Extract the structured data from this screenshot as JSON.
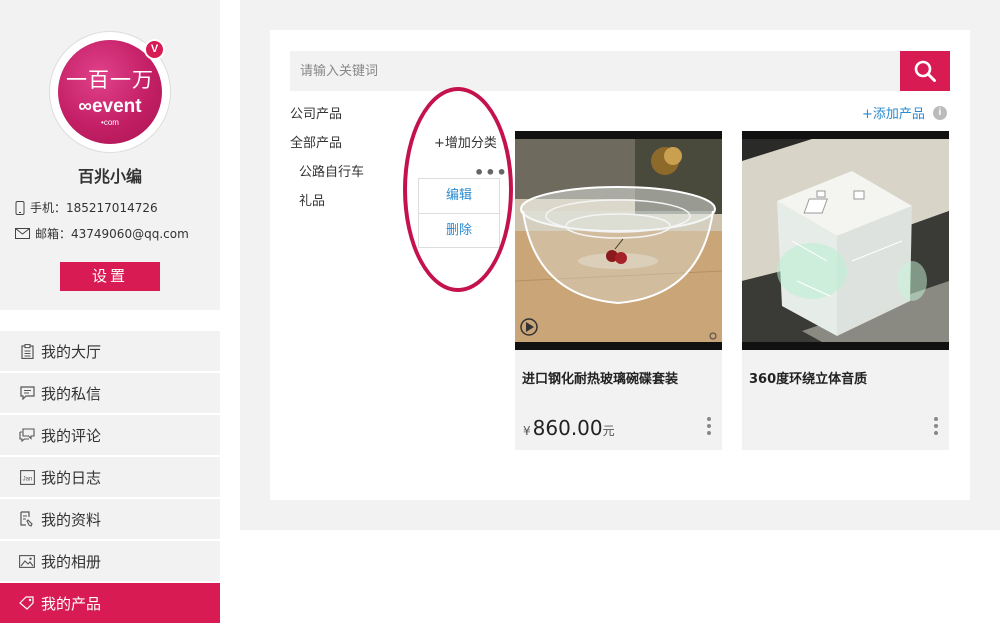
{
  "profile": {
    "avatar_text": {
      "cn": "一百一万",
      "en": "event",
      "com": "•com"
    },
    "badge": "V",
    "name": "百兆小编",
    "phone": "手机：185217014726",
    "email": "邮箱：43749060@qq.com",
    "settings_label": "设置"
  },
  "nav": {
    "items": [
      {
        "label": "我的大厅",
        "icon": "clipboard-icon"
      },
      {
        "label": "我的私信",
        "icon": "message-icon"
      },
      {
        "label": "我的评论",
        "icon": "comment-icon"
      },
      {
        "label": "我的日志",
        "icon": "calendar-icon"
      },
      {
        "label": "我的资料",
        "icon": "profile-edit-icon"
      },
      {
        "label": "我的相册",
        "icon": "photo-icon"
      },
      {
        "label": "我的产品",
        "icon": "product-tag-icon",
        "active": true
      }
    ],
    "calendar_icon_text": "Jan"
  },
  "search": {
    "placeholder": "请输入关键词"
  },
  "categories": {
    "company": "公司产品",
    "all": "全部产品",
    "add_category": "+增加分类",
    "subs": [
      "公路自行车",
      "礼品"
    ],
    "menu": {
      "edit": "编辑",
      "delete": "删除"
    }
  },
  "add_product": "+添加产品",
  "products": [
    {
      "name": "进口钢化耐热玻璃碗碟套装",
      "currency": "¥",
      "price": "860.00",
      "unit": "元"
    },
    {
      "name": "360度环绕立体音质",
      "currency": "",
      "price": "",
      "unit": ""
    }
  ],
  "colors": {
    "accent": "#d81b52",
    "link": "#2a8bd0",
    "panel_bg": "#f2f2f2"
  }
}
